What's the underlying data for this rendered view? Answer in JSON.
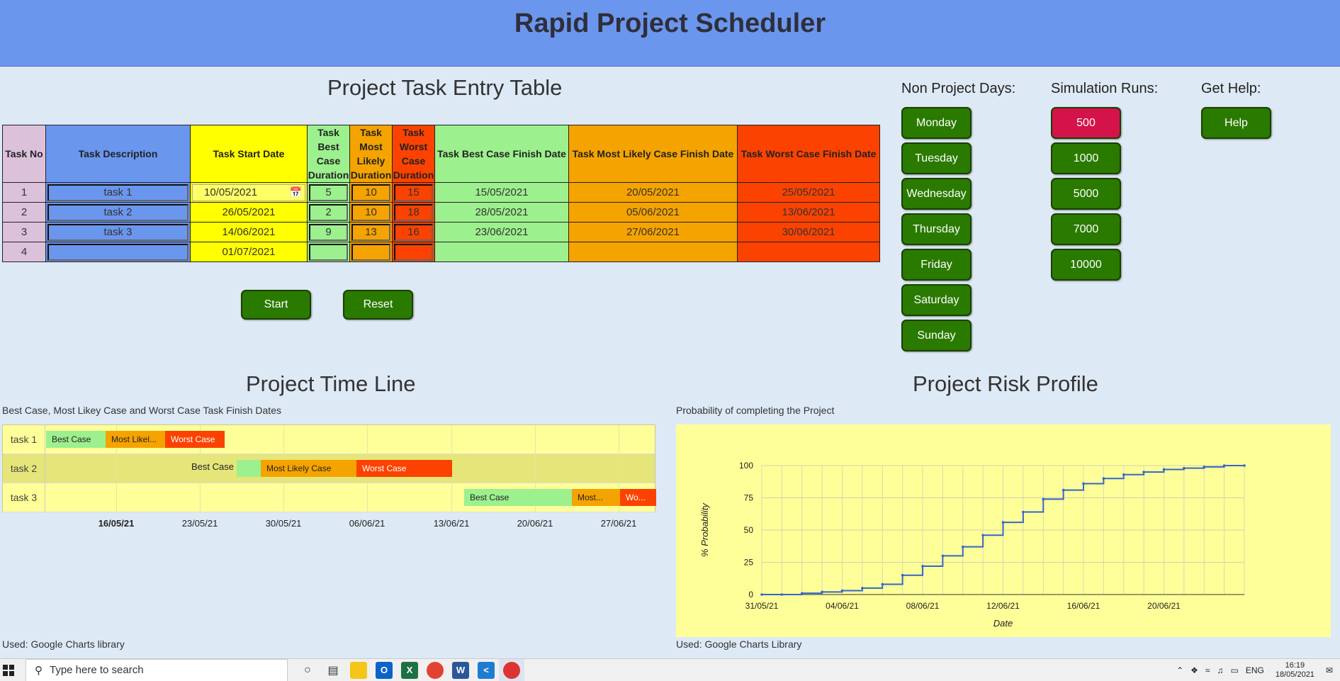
{
  "app_title": "Rapid Project Scheduler",
  "entry_section": {
    "title": "Project Task Entry Table",
    "headers": [
      "Task No",
      "Task Description",
      "Task Start Date",
      "Task Best Case Duration",
      "Task Most Likely Duration",
      "Task Worst Case Duration",
      "Task Best Case Finish Date",
      "Task Most Likely Case Finish Date",
      "Task Worst Case Finish Date"
    ],
    "rows": [
      {
        "no": "1",
        "desc": "task 1",
        "start": "10/05/2021",
        "best": "5",
        "likely": "10",
        "worst": "15",
        "best_finish": "15/05/2021",
        "likely_finish": "20/05/2021",
        "worst_finish": "25/05/2021"
      },
      {
        "no": "2",
        "desc": "task 2",
        "start": "26/05/2021",
        "best": "2",
        "likely": "10",
        "worst": "18",
        "best_finish": "28/05/2021",
        "likely_finish": "05/06/2021",
        "worst_finish": "13/06/2021"
      },
      {
        "no": "3",
        "desc": "task 3",
        "start": "14/06/2021",
        "best": "9",
        "likely": "13",
        "worst": "16",
        "best_finish": "23/06/2021",
        "likely_finish": "27/06/2021",
        "worst_finish": "30/06/2021"
      },
      {
        "no": "4",
        "desc": "",
        "start": "01/07/2021",
        "best": "",
        "likely": "",
        "worst": "",
        "best_finish": "",
        "likely_finish": "",
        "worst_finish": ""
      }
    ],
    "start_label": "Start",
    "reset_label": "Reset"
  },
  "non_project_days": {
    "title": "Non Project Days:",
    "days": [
      "Monday",
      "Tuesday",
      "Wednesday",
      "Thursday",
      "Friday",
      "Saturday",
      "Sunday"
    ]
  },
  "simulation_runs": {
    "title": "Simulation Runs:",
    "runs": [
      "500",
      "1000",
      "5000",
      "7000",
      "10000"
    ],
    "selected": "500"
  },
  "help": {
    "title": "Get Help:",
    "button": "Help"
  },
  "timeline": {
    "title": "Project Time Line",
    "subtitle": "Best Case, Most Likey Case and Worst Case Task Finish Dates",
    "footer": "Used: Google Charts library",
    "tasks": [
      {
        "name": "task 1",
        "bars": [
          {
            "label": "Best Case",
            "type": "best"
          },
          {
            "label": "Most Likel...",
            "type": "likely"
          },
          {
            "label": "Worst Case",
            "type": "worst"
          }
        ]
      },
      {
        "name": "task 2",
        "outside_label": "Best Case",
        "bars": [
          {
            "label": "",
            "type": "best"
          },
          {
            "label": "Most Likely Case",
            "type": "likely"
          },
          {
            "label": "Worst Case",
            "type": "worst"
          }
        ]
      },
      {
        "name": "task 3",
        "bars": [
          {
            "label": "Best Case",
            "type": "best"
          },
          {
            "label": "Most...",
            "type": "likely"
          },
          {
            "label": "Wo...",
            "type": "worst"
          }
        ]
      }
    ],
    "ticks": [
      "16/05/21",
      "23/05/21",
      "30/05/21",
      "06/06/21",
      "13/06/21",
      "20/06/21",
      "27/06/21"
    ]
  },
  "risk": {
    "title": "Project Risk Profile",
    "subtitle": "Probability of completing the Project",
    "footer": "Used: Google Charts Library"
  },
  "chart_data": {
    "type": "line",
    "title": "",
    "xlabel": "Date",
    "ylabel": "% Probability",
    "x_ticks": [
      "31/05/21",
      "04/06/21",
      "08/06/21",
      "12/06/21",
      "16/06/21",
      "20/06/21"
    ],
    "y_ticks": [
      0,
      25,
      50,
      75,
      100
    ],
    "ylim": [
      0,
      100
    ],
    "x": [
      "31/05/21",
      "01/06/21",
      "02/06/21",
      "03/06/21",
      "04/06/21",
      "05/06/21",
      "06/06/21",
      "07/06/21",
      "08/06/21",
      "09/06/21",
      "10/06/21",
      "11/06/21",
      "12/06/21",
      "13/06/21",
      "14/06/21",
      "15/06/21",
      "16/06/21",
      "17/06/21",
      "18/06/21",
      "19/06/21",
      "20/06/21",
      "21/06/21",
      "22/06/21",
      "23/06/21",
      "24/06/21"
    ],
    "series": [
      {
        "values": [
          0,
          0,
          1,
          2,
          3,
          5,
          8,
          15,
          22,
          30,
          37,
          46,
          56,
          64,
          74,
          81,
          86,
          90,
          93,
          95,
          97,
          98,
          99,
          100,
          100
        ]
      }
    ],
    "grid": true,
    "color": "#3366cc"
  },
  "taskbar": {
    "search_placeholder": "Type here to search",
    "lang": "ENG",
    "time": "16:19",
    "date": "18/05/2021"
  }
}
